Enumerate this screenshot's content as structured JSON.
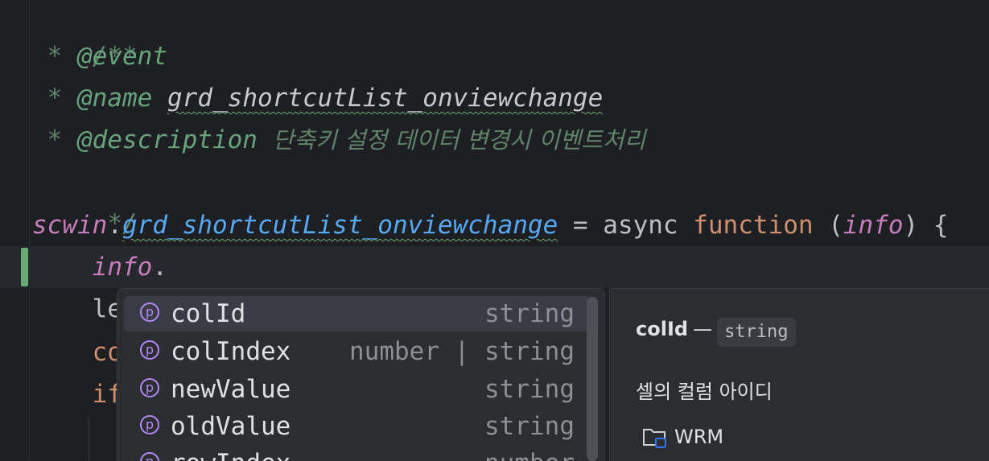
{
  "code": {
    "l1": "/**",
    "l2_star": " * ",
    "l2_tag": "@event",
    "l3_star": " * ",
    "l3_tag": "@name",
    "l3_value": "grd_shortcutList_onviewchange",
    "l4_star": " * ",
    "l4_tag": "@description",
    "l4_text": "단축키 설정 데이터 변경시 이벤트처리",
    "l5": " */",
    "l6_obj": "scwin",
    "l6_dot": ".",
    "l6_fn": "grd_shortcutList_onviewchange",
    "l6_eq": " = async ",
    "l6_kw": "function",
    "l6_open": " (",
    "l6_param": "info",
    "l6_close": ") {",
    "l7_indent": "    ",
    "l7_ident": "info",
    "l7_dot": ".",
    "l8_prefix": "    le",
    "l9_prefix": "    co",
    "l10_prefix": "    if"
  },
  "completion": {
    "items": [
      {
        "name": "colId",
        "type": "string"
      },
      {
        "name": "colIndex",
        "type": "number | string"
      },
      {
        "name": "newValue",
        "type": "string"
      },
      {
        "name": "oldValue",
        "type": "string"
      },
      {
        "name": "rowIndex",
        "type": "number"
      }
    ],
    "icon_glyph": "p",
    "selected_index": 0
  },
  "doc": {
    "name": "colId",
    "dash": "—",
    "type": "string",
    "description": "셀의 컬럼 아이디",
    "module": "WRM"
  },
  "colors": {
    "background": "#1e1f22",
    "popup": "#2b2d30",
    "selection": "#393c44",
    "property_icon": "#b189f5",
    "change_marker": "#6aab73"
  }
}
